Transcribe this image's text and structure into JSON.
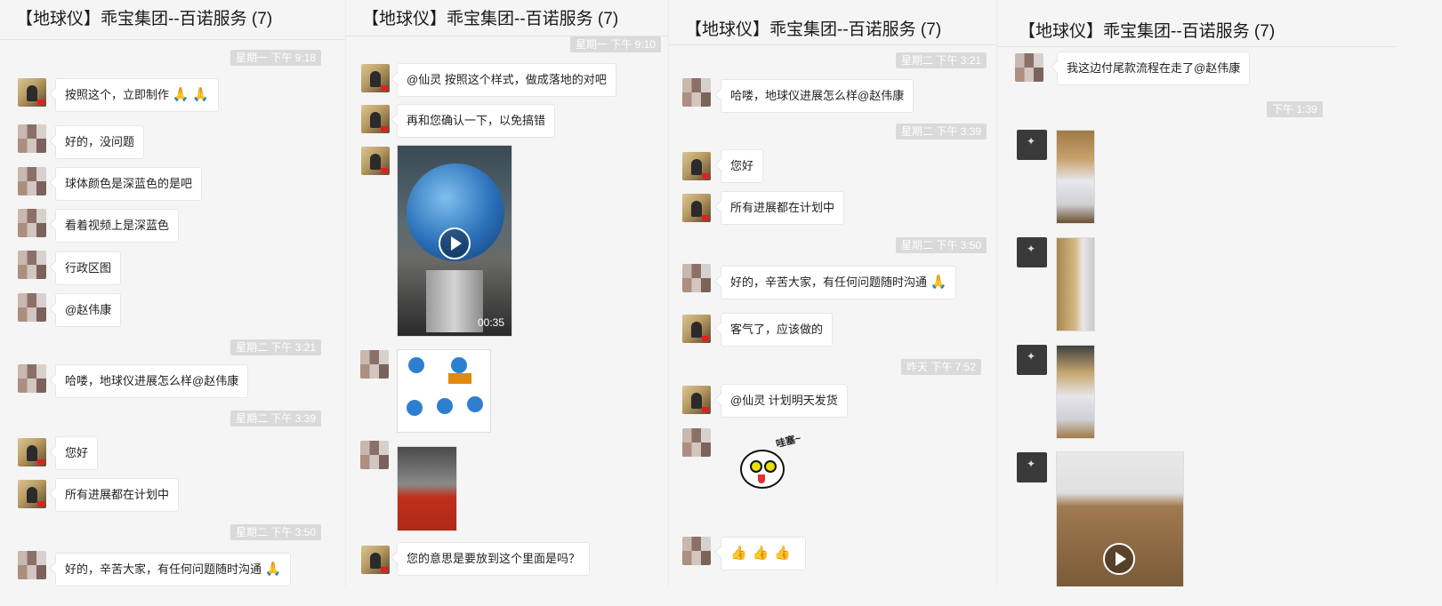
{
  "title": "【地球仪】乖宝集团--百诺服务 (7)",
  "p1": {
    "ts": [
      "星期一 下午 9:18",
      "星期二 下午 3:21",
      "星期二 下午 3:39",
      "星期二 下午 3:50"
    ],
    "m": [
      "按照这个，立即制作",
      "好的，没问题",
      "球体颜色是深蓝色的是吧",
      "看着视频上是深蓝色",
      "行政区图",
      "@赵伟康",
      "哈喽，地球仪进展怎么样@赵伟康",
      "您好",
      "所有进展都在计划中",
      "好的，辛苦大家，有任何问题随时沟通"
    ]
  },
  "p2": {
    "ts": [
      "星期一 下午 9:10"
    ],
    "m": [
      "@仙灵 按照这个样式，做成落地的对吧",
      "再和您确认一下，以免搞错",
      "您的意思是要放到这个里面是吗？"
    ],
    "video_duration": "00:35"
  },
  "p3": {
    "ts": [
      "星期二 下午 3:21",
      "星期二 下午 3:39",
      "星期二 下午 3:50",
      "昨天 下午 7:52"
    ],
    "m": [
      "哈喽，地球仪进展怎么样@赵伟康",
      "您好",
      "所有进展都在计划中",
      "好的，辛苦大家，有任何问题随时沟通",
      "客气了，应该做的",
      "@仙灵 计划明天发货"
    ],
    "sticker_text": "哇塞~"
  },
  "p4": {
    "ts": [
      "下午 1:39"
    ],
    "m": [
      "我这边付尾款流程在走了@赵伟康"
    ]
  },
  "emoji": {
    "pray": "🙏",
    "thumbs": "👍👍👍"
  },
  "colors": {
    "bg": "#f5f5f5",
    "timestamp_bg": "#dadada",
    "header_border": "#e4e4e4"
  }
}
